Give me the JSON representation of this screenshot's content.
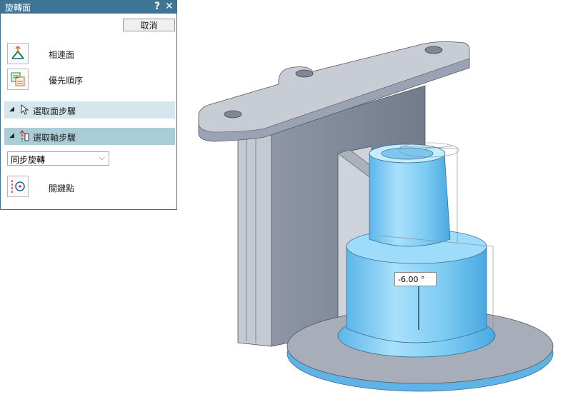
{
  "dialog": {
    "title": "旋轉面",
    "help_icon": "?",
    "close_icon": "✕",
    "cancel_label": "取消",
    "adjacent_faces_label": "相連面",
    "priority_label": "優先順序",
    "section_select_face": "選取面步驟",
    "section_select_axis": "選取軸步驟",
    "mode_value": "同步旋轉",
    "keypoint_label": "關鍵點"
  },
  "viewport": {
    "angle_value": "-6.00 °"
  },
  "colors": {
    "title_bar": "#3d7596",
    "section_inactive": "#d6e6ee",
    "section_active": "#a9ced9",
    "part_highlight": "#6ec6f3",
    "part_gray": "#9aa3b3"
  },
  "icons": {
    "help": "question-icon",
    "close": "close-icon",
    "adjacent": "adjacent-faces-icon",
    "priority": "priority-icon",
    "select_face": "select-face-icon",
    "select_axis": "select-axis-icon",
    "keypoint": "keypoint-icon"
  }
}
